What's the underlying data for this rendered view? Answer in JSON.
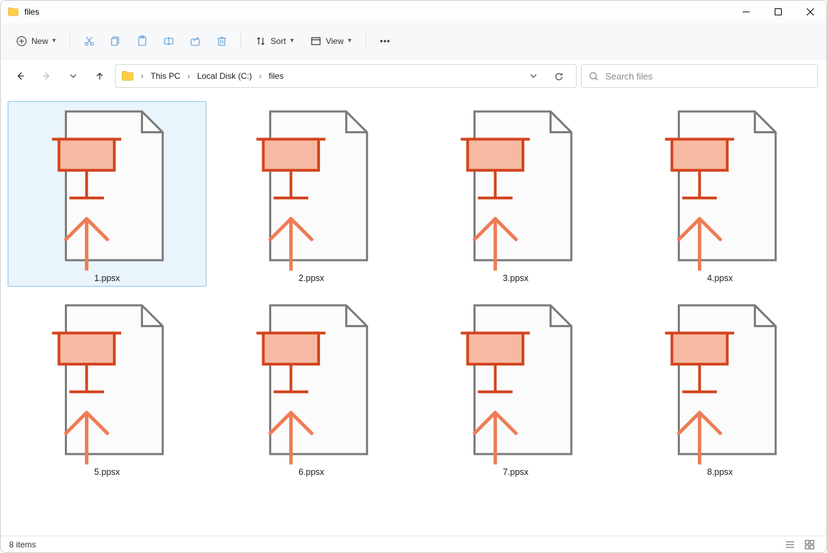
{
  "window": {
    "title": "files"
  },
  "toolbar": {
    "new_label": "New",
    "sort_label": "Sort",
    "view_label": "View"
  },
  "breadcrumbs": [
    "This PC",
    "Local Disk (C:)",
    "files"
  ],
  "search": {
    "placeholder": "Search files"
  },
  "files": [
    {
      "name": "1.ppsx",
      "selected": true
    },
    {
      "name": "2.ppsx",
      "selected": false
    },
    {
      "name": "3.ppsx",
      "selected": false
    },
    {
      "name": "4.ppsx",
      "selected": false
    },
    {
      "name": "5.ppsx",
      "selected": false
    },
    {
      "name": "6.ppsx",
      "selected": false
    },
    {
      "name": "7.ppsx",
      "selected": false
    },
    {
      "name": "8.ppsx",
      "selected": false
    }
  ],
  "status": {
    "item_count_text": "8 items"
  }
}
